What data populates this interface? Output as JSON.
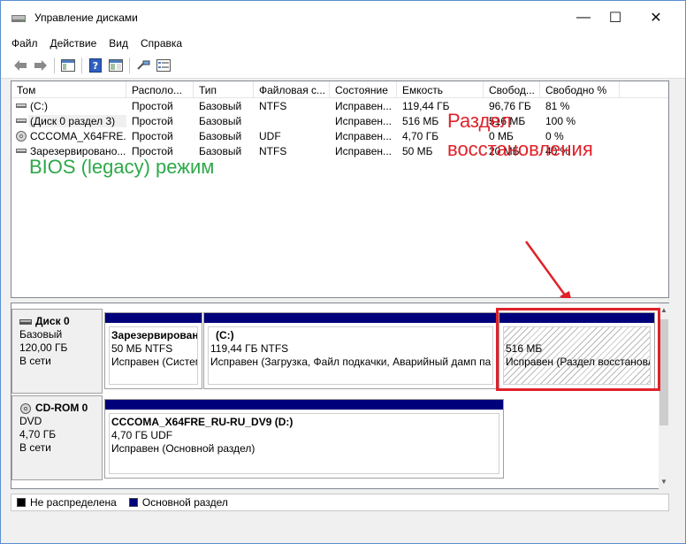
{
  "window": {
    "title": "Управление дисками",
    "controls": {
      "minimize": "—",
      "maximize": "☐",
      "close": "✕"
    }
  },
  "menu": [
    "Файл",
    "Действие",
    "Вид",
    "Справка"
  ],
  "toolbar": {
    "icons": [
      "back-arrow-icon",
      "forward-arrow-icon",
      "console-tree-icon",
      "help-icon",
      "properties-icon",
      "connect-icon",
      "view-icon"
    ]
  },
  "volume_table": {
    "columns": [
      "Том",
      "Располо...",
      "Тип",
      "Файловая с...",
      "Состояние",
      "Емкость",
      "Свобод...",
      "Свободно %"
    ],
    "rows": [
      [
        "(C:)",
        "Простой",
        "Базовый",
        "NTFS",
        "Исправен...",
        "119,44 ГБ",
        "96,76 ГБ",
        "81 %"
      ],
      [
        "(Диск 0 раздел 3)",
        "Простой",
        "Базовый",
        "",
        "Исправен...",
        "516 МБ",
        "516 МБ",
        "100 %"
      ],
      [
        "CCCOMA_X64FRE...",
        "Простой",
        "Базовый",
        "UDF",
        "Исправен...",
        "4,70 ГБ",
        "0 МБ",
        "0 %"
      ],
      [
        "Зарезервировано...",
        "Простой",
        "Базовый",
        "NTFS",
        "Исправен...",
        "50 МБ",
        "20 МБ",
        "40 %"
      ]
    ]
  },
  "annotations": {
    "bios": "BIOS (legacy) режим",
    "recovery_line1": "Раздел",
    "recovery_line2": "восстановления",
    "color_bios": "#2ea84a",
    "color_recovery": "#e0212a"
  },
  "disks": [
    {
      "name": "Диск 0",
      "type": "Базовый",
      "size": "120,00 ГБ",
      "status": "В сети",
      "partitions": [
        {
          "title": "Зарезервирован",
          "size": "50 МБ NTFS",
          "status": "Исправен (Систем"
        },
        {
          "title": "(C:)",
          "size": "119,44 ГБ NTFS",
          "status": "Исправен (Загрузка, Файл подкачки, Аварийный дамп па"
        },
        {
          "title": "",
          "size": "516 МБ",
          "status": "Исправен (Раздел восстановл"
        }
      ]
    },
    {
      "name": "CD-ROM 0",
      "type": "DVD",
      "size": "4,70 ГБ",
      "status": "В сети",
      "partitions": [
        {
          "title": "CCCOMA_X64FRE_RU-RU_DV9  (D:)",
          "size": "4,70 ГБ UDF",
          "status": "Исправен (Основной раздел)"
        }
      ]
    }
  ],
  "legend": [
    {
      "label": "Не распределена",
      "color": "#000000"
    },
    {
      "label": "Основной раздел",
      "color": "#00007b"
    }
  ],
  "colors": {
    "primary_partition": "#00007b",
    "highlight": "#e0212a"
  }
}
